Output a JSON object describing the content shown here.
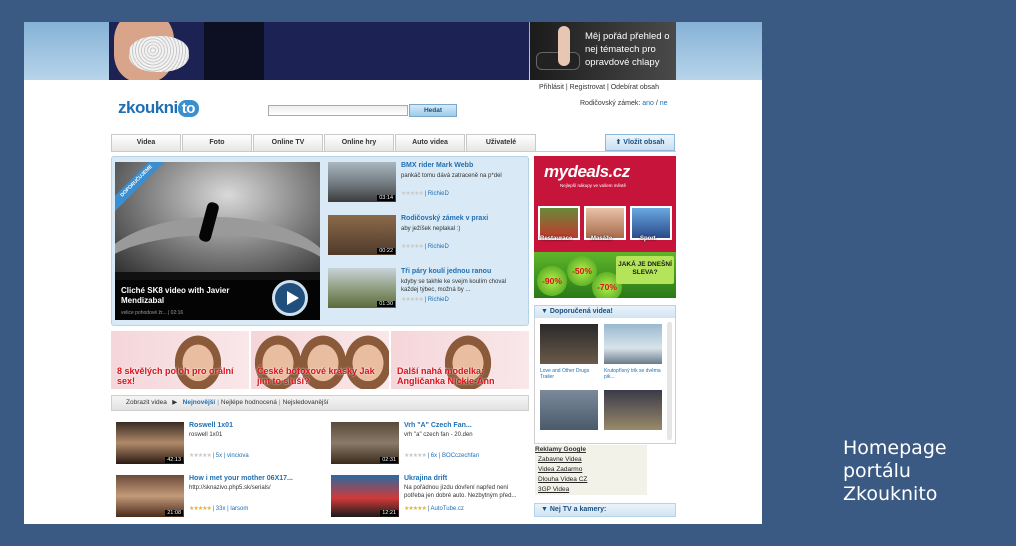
{
  "caption": [
    "Homepage",
    "portálu",
    "Zkouknito"
  ],
  "banner": {
    "right_text": "Mêj pořád přehled o nej tématech pro opravdové chlapy"
  },
  "header": {
    "logo_main": "zkoukni",
    "logo_bubble": "to",
    "links": "Přihlásit | Registrovat | Odebírat obsah",
    "search_button": "Hedat",
    "parental_label": "Rodičovský zámek:",
    "parental_yes": "ano",
    "parental_sep": " / ",
    "parental_no": "ne"
  },
  "nav": {
    "tabs": [
      "Videa",
      "Foto",
      "Online TV",
      "Online hry",
      "Auto videa",
      "Uživatelé"
    ],
    "upload": "⬆ Vložit obsah"
  },
  "featured": {
    "ribbon": "DOPORUČUJEME",
    "title": "Cliché SK8 video with Javier Mendizabal",
    "meta": "velice pohodové žr... | 02:16",
    "videos": [
      {
        "title": "BMX rider Mark Webb",
        "desc": "pankáč tomu dává zatraceně na p*del",
        "duration": "03:14",
        "user": "| RichieD",
        "stars_on": "",
        "stars_off": "★★★★★"
      },
      {
        "title": "Rodičovský zámek v praxi",
        "desc": "aby ježíšek neplakal :)",
        "duration": "00:22",
        "user": "| RichieD",
        "stars_on": "",
        "stars_off": "★★★★★"
      },
      {
        "title": "Tři páry koulí jednou ranou",
        "desc": "kdyby se takhle ke svejm koulím choval každej týbec, možná by ...",
        "duration": "01:30",
        "user": "| RichieD",
        "stars_on": "",
        "stars_off": "★★★★★"
      }
    ]
  },
  "promos": [
    "8 skvělých poloh pro orální sex!",
    "České botoxové krásky Jak jim to sluší?",
    "Další nahá modelka: Angličanka Nickie-Ann"
  ],
  "list": {
    "label": "Zobrazit videa",
    "arrow": "▶",
    "sort_new": "Nejnovější",
    "sort_best": "Nejlépe hodnocená",
    "sort_most": "Nejsledovanější",
    "items": [
      {
        "title": "Roswell 1x01",
        "desc": "roswell 1x01",
        "duration": "42:13",
        "stats": "| 5x | vinciova",
        "stars_on": "",
        "stars_off": "★★★★★"
      },
      {
        "title": "Vrh \"A\" Czech Fan...",
        "desc": "vrh \"a\" czech fan - 20.den",
        "duration": "02:31",
        "stats": "| 6x | BOCczechfan",
        "stars_on": "",
        "stars_off": "★★★★★"
      },
      {
        "title": "How i met your mother 06X17...",
        "desc": "http://sknazivo.php5.sk/serials/",
        "duration": "21:08",
        "stats": "| 33x | larsom",
        "stars_on": "★★★★★",
        "stars_off": ""
      },
      {
        "title": "Ukrajina drift",
        "desc": "Na pořádnou jízdu dovření napřed není potřeba jen dobré auto. Nezbytným před...",
        "duration": "12:21",
        "stats": "| AutoTube.cz",
        "stars_on": "★★★★★",
        "stars_off": ""
      }
    ]
  },
  "mydeals": {
    "logo": "mydeals.cz",
    "tagline": "Nejlepší nákupy ve vašem městě",
    "tiles": [
      "Restaurace",
      "Masáže",
      "Sport"
    ],
    "discounts": [
      "-90%",
      "-50%",
      "-70%"
    ],
    "ask": "JAKÁ JE DNEŠNÍ SLEVA?"
  },
  "recommended": {
    "title": "▼ Doporučená videa!",
    "items": [
      "Love and Other Drugs Trailer",
      "Krutopřísný trik se dvěma pik...",
      "",
      ""
    ]
  },
  "ads": {
    "title": "Reklamy Google",
    "links": [
      "Zabavne Videa",
      "Videa Zadarmo",
      "Dlouha Videa CZ",
      "3GP Videa"
    ]
  },
  "tv_panel": {
    "title": "▼ Nej TV a kamery:"
  }
}
